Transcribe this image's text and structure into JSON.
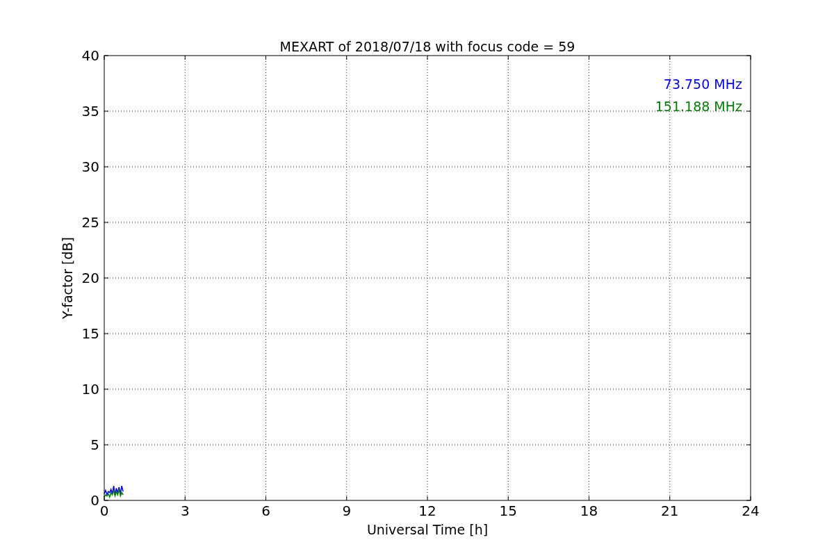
{
  "figure": {
    "chart_data": {
      "type": "line",
      "title": "MEXART of 2018/07/18 with focus code = 59",
      "xlabel": "Universal Time [h]",
      "ylabel": "Y-factor [dB]",
      "x": [
        0,
        0.05,
        0.1,
        0.15,
        0.2,
        0.25,
        0.3,
        0.35,
        0.4,
        0.45,
        0.5,
        0.55,
        0.6,
        0.65,
        0.7
      ],
      "series": [
        {
          "name": "73.750 MHz",
          "color": "#0000ff",
          "values": [
            0.6,
            0.9,
            0.5,
            0.8,
            0.7,
            1.0,
            0.6,
            1.3,
            0.5,
            1.1,
            0.7,
            1.2,
            0.6,
            1.3,
            0.8
          ]
        },
        {
          "name": "151.188 MHz",
          "color": "#008000",
          "values": [
            0.3,
            0.5,
            0.4,
            0.6,
            0.3,
            0.7,
            0.5,
            0.9,
            0.4,
            0.8,
            0.5,
            1.0,
            0.4,
            0.7,
            0.5
          ]
        }
      ],
      "xlim": [
        0,
        24
      ],
      "ylim": [
        0,
        40
      ],
      "xticks": [
        0,
        3,
        6,
        9,
        12,
        15,
        18,
        21,
        24
      ],
      "yticks": [
        0,
        5,
        10,
        15,
        20,
        25,
        30,
        35,
        40
      ],
      "grid": true
    }
  }
}
